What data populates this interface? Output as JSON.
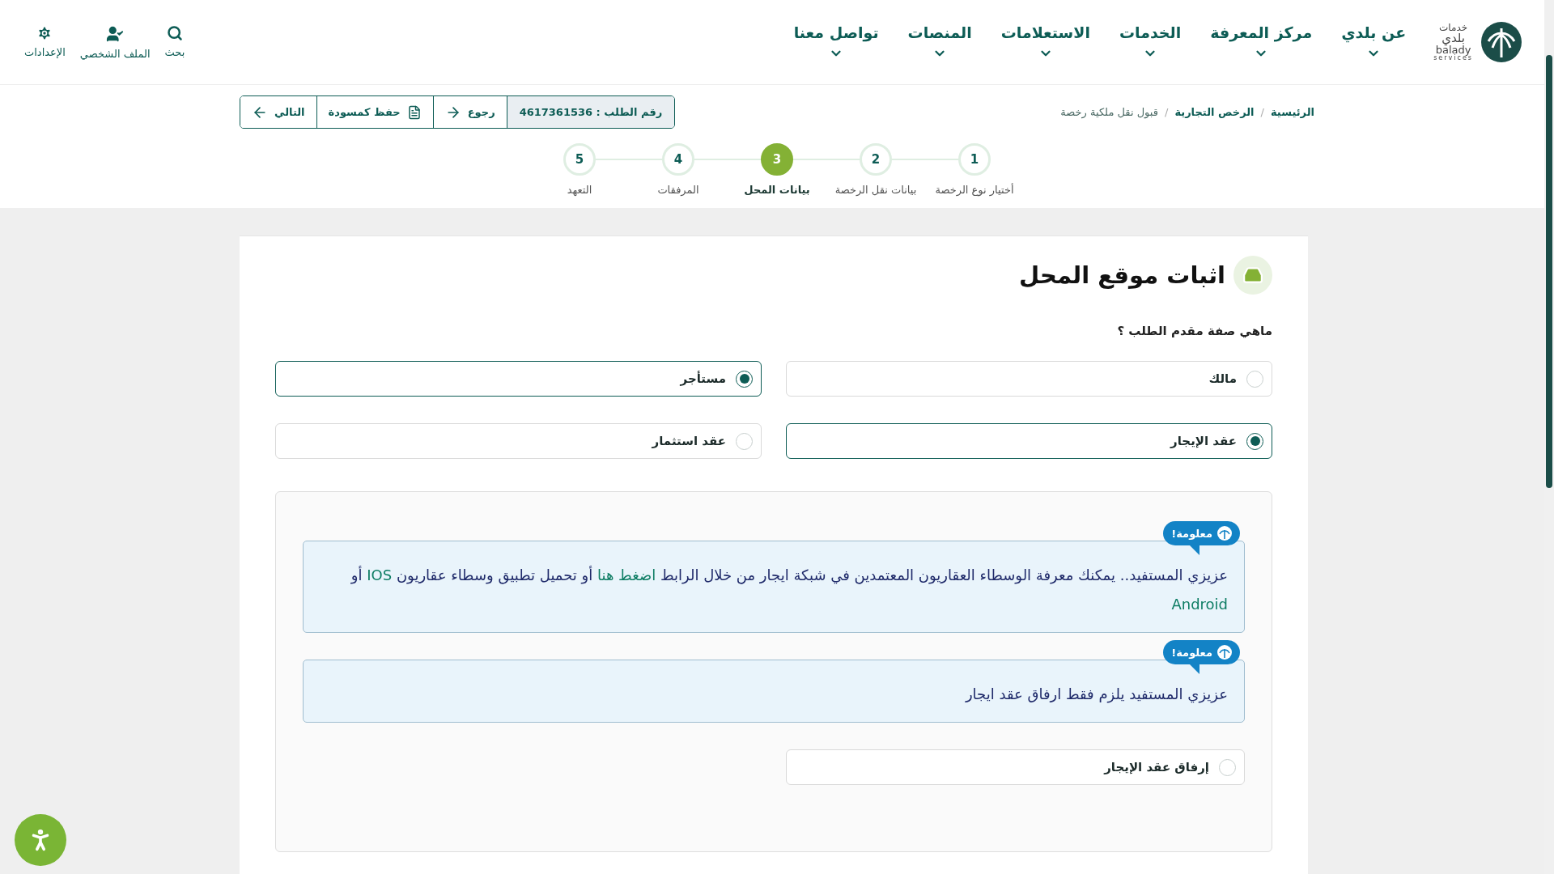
{
  "logo": {
    "arabic_top": "خدمات",
    "arabic": "بلدي",
    "latin": "balady",
    "tagline": "services"
  },
  "nav": [
    {
      "label": "عن بلدي"
    },
    {
      "label": "مركز المعرفة"
    },
    {
      "label": "الخدمات"
    },
    {
      "label": "الاستعلامات"
    },
    {
      "label": "المنصات"
    },
    {
      "label": "تواصل معنا"
    }
  ],
  "utility": [
    {
      "kind": "search",
      "label": "بحث"
    },
    {
      "kind": "profile",
      "label": "الملف الشخصي"
    },
    {
      "kind": "settings",
      "label": "الإعدادات"
    }
  ],
  "breadcrumb_separator": "/",
  "breadcrumb": [
    {
      "label": "الرئيسية",
      "current": false
    },
    {
      "label": "الرخص التجارية",
      "current": false
    },
    {
      "label": "قبول نقل ملكية رخصة",
      "current": true
    }
  ],
  "toolbar": {
    "request_number": "رقم الطلب : 4617361536",
    "actions": [
      {
        "kind": "back",
        "label": "رجوع"
      },
      {
        "kind": "draft",
        "label": "حفظ كمسودة"
      },
      {
        "kind": "next",
        "label": "التالي"
      }
    ]
  },
  "steps": [
    {
      "number": "1",
      "label": "أختيار نوع الرخصة",
      "selected": false
    },
    {
      "number": "2",
      "label": "بيانات نقل الرخصة",
      "selected": false
    },
    {
      "number": "3",
      "label": "بيانات المحل",
      "selected": true
    },
    {
      "number": "4",
      "label": "المرفقات",
      "selected": false
    },
    {
      "number": "5",
      "label": "التعهد",
      "selected": false
    }
  ],
  "section_title": "اثبات موقع المحل",
  "question": "ماهي صفة مقدم الطلب ؟",
  "options": [
    {
      "label": "مالك",
      "selected": false
    },
    {
      "label": "مستأجر",
      "selected": true
    },
    {
      "label": "عقد الإيجار",
      "selected": true
    },
    {
      "label": "عقد استثمار",
      "selected": false
    }
  ],
  "notices": [
    {
      "badge": "معلومة!",
      "segments": [
        {
          "text": "عزيزي المستفيد.. يمكنك معرفة الوسطاء العقاريون المعتمدين في شبكة ايجار من خلال الرابط ",
          "link": false
        },
        {
          "text": "اضغط هنا",
          "link": true
        },
        {
          "text": " أو تحميل تطبيق وسطاء عقاريون ",
          "link": false
        },
        {
          "text": "IOS",
          "link": true
        },
        {
          "text": " أو ",
          "link": false
        },
        {
          "text": "Android",
          "link": true
        }
      ]
    },
    {
      "badge": "معلومة!",
      "segments": [
        {
          "text": "عزيزي المستفيد يلزم فقط ارفاق عقد ايجار",
          "link": false
        }
      ]
    }
  ],
  "attach_option": {
    "label": "إرفاق عقد الإيجار",
    "selected": false
  }
}
